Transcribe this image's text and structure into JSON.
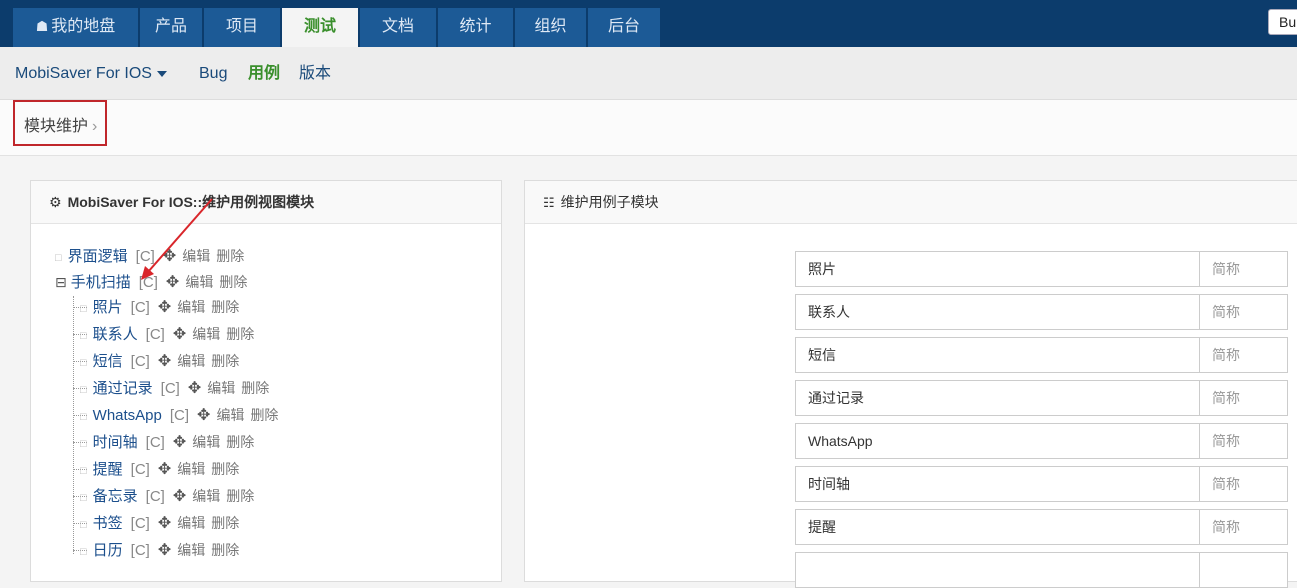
{
  "topnav": {
    "home_icon": "home-icon",
    "items": [
      {
        "label": "我的地盘"
      },
      {
        "label": "产品"
      },
      {
        "label": "项目"
      },
      {
        "label": "测试"
      },
      {
        "label": "文档"
      },
      {
        "label": "统计"
      },
      {
        "label": "组织"
      },
      {
        "label": "后台"
      }
    ],
    "active_index": 3,
    "corner_label": "Bu"
  },
  "subnav": {
    "product": "MobiSaver For IOS",
    "items": [
      "Bug",
      "用例",
      "版本"
    ],
    "active": "用例"
  },
  "breadcrumb": {
    "label": "模块维护",
    "sep": "›"
  },
  "left_panel": {
    "title": "MobiSaver For IOS::维护用例视图模块",
    "tree": [
      {
        "name": "界面逻辑",
        "meta": "[C]",
        "edit": "编辑",
        "del": "删除"
      },
      {
        "name": "手机扫描",
        "meta": "[C]",
        "edit": "编辑",
        "del": "删除"
      },
      {
        "name": "照片",
        "meta": "[C]",
        "edit": "编辑",
        "del": "删除"
      },
      {
        "name": "联系人",
        "meta": "[C]",
        "edit": "编辑",
        "del": "删除"
      },
      {
        "name": "短信",
        "meta": "[C]",
        "edit": "编辑",
        "del": "删除"
      },
      {
        "name": "通过记录",
        "meta": "[C]",
        "edit": "编辑",
        "del": "删除"
      },
      {
        "name": "WhatsApp",
        "meta": "[C]",
        "edit": "编辑",
        "del": "删除"
      },
      {
        "name": "时间轴",
        "meta": "[C]",
        "edit": "编辑",
        "del": "删除"
      },
      {
        "name": "提醒",
        "meta": "[C]",
        "edit": "编辑",
        "del": "删除"
      },
      {
        "name": "备忘录",
        "meta": "[C]",
        "edit": "编辑",
        "del": "删除"
      },
      {
        "name": "书签",
        "meta": "[C]",
        "edit": "编辑",
        "del": "删除"
      },
      {
        "name": "日历",
        "meta": "[C]",
        "edit": "编辑",
        "del": "删除"
      }
    ]
  },
  "right_panel": {
    "title": "维护用例子模块",
    "children": [
      {
        "name": "照片",
        "short_placeholder": "简称"
      },
      {
        "name": "联系人",
        "short_placeholder": "简称"
      },
      {
        "name": "短信",
        "short_placeholder": "简称"
      },
      {
        "name": "通过记录",
        "short_placeholder": "简称"
      },
      {
        "name": "WhatsApp",
        "short_placeholder": "简称"
      },
      {
        "name": "时间轴",
        "short_placeholder": "简称"
      },
      {
        "name": "提醒",
        "short_placeholder": "简称"
      },
      {
        "name": "",
        "short_placeholder": ""
      }
    ]
  },
  "colors": {
    "nav_bg": "#0c3c6c",
    "nav_item_bg": "#1c5a96",
    "active_green": "#3a8f2c",
    "link_blue": "#1c4f8c",
    "annotation_red": "#c0262b"
  }
}
